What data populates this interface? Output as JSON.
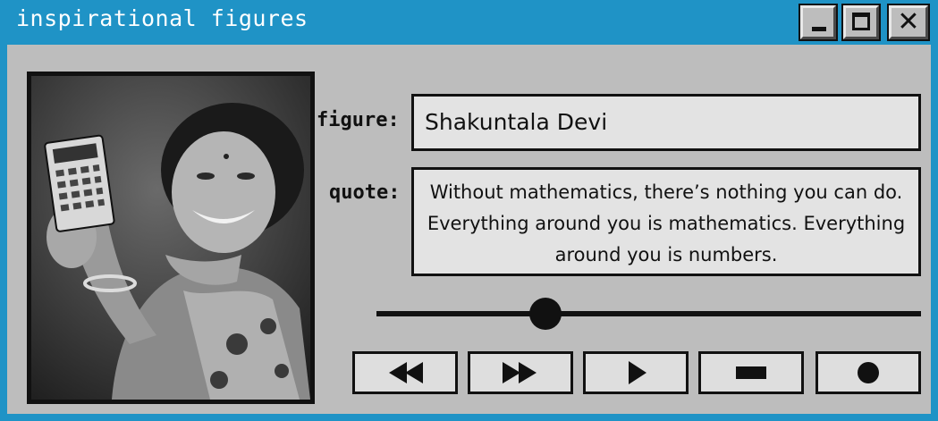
{
  "window": {
    "title": "inspirational figures",
    "controls": [
      "minimize",
      "maximize",
      "close"
    ],
    "colors": {
      "titlebar": "#1f93c6",
      "client": "#bdbdbd",
      "field": "#e3e3e3"
    }
  },
  "content": {
    "figure_label": "figure:",
    "figure_value": "Shakuntala Devi",
    "quote_label": "quote:",
    "quote_value": "Without mathematics, there’s nothing you can do. Everything around you is mathematics. Everything around you is numbers."
  },
  "slider": {
    "position_fraction": 0.31
  },
  "media_controls": [
    "rewind-icon",
    "fast-forward-icon",
    "play-icon",
    "stop-icon",
    "record-icon"
  ]
}
